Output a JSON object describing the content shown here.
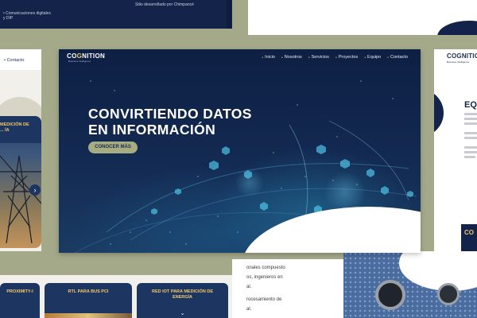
{
  "top_left_tile": {
    "line1": "• Comunicaciones digitales",
    "line2": "y DIP",
    "credit": "Sitio desarrollado por Chimpancé"
  },
  "left_tile": {
    "nav_contact": "• Contacto",
    "card_title": "MEDICIÓN DE ... ÍA",
    "arrow": "›"
  },
  "hero": {
    "brand_main": "CO",
    "brand_accent": "G",
    "brand_rest": "NITION",
    "tagline": "Business Intelligence",
    "nav": [
      "Inicio",
      "Nosotros",
      "Servicios",
      "Proyectos",
      "Equipo",
      "Contacto"
    ],
    "headline_line1": "CONVIRTIENDO DATOS",
    "headline_line2": "EN INFORMACIÓN",
    "cta_label": "CONOCER MÁS"
  },
  "right_tile": {
    "logo": "COGNITION",
    "logo_sub": "Business Intelligence",
    "section_title": "EQ",
    "bottom_title": "CO"
  },
  "bottom_cards": [
    {
      "label": "PROXIMITY-I",
      "chevron": "⌄"
    },
    {
      "label": "RTL PARA BUS PCI",
      "chevron": "⌄"
    },
    {
      "label": "RED IOT PARA MEDICIÓN DE ENERGÍA",
      "chevron": "⌄"
    }
  ],
  "bottom_center_text": {
    "l1": "onales compuesto",
    "l2": "os, ingenieros en",
    "l3": "al.",
    "l4": "rocesamiento de",
    "l5": "al."
  },
  "colors": {
    "navy": "#13234a",
    "gold": "#f3c66b",
    "olive": "#a7ad82",
    "backdrop": "#a4a98a"
  }
}
